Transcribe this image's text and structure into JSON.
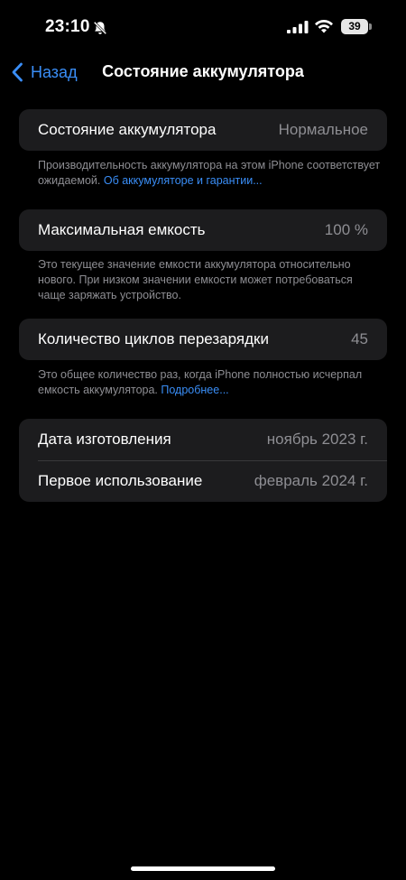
{
  "status_bar": {
    "time": "23:10",
    "battery_level": "39",
    "icons": [
      "bell-slash-icon",
      "cellular-signal-icon",
      "wifi-icon",
      "battery-icon"
    ]
  },
  "nav": {
    "back_label": "Назад",
    "title": "Состояние аккумулятора"
  },
  "sections": {
    "health": {
      "label": "Состояние аккумулятора",
      "value": "Нормальное",
      "note": "Производительность аккумулятора на этом iPhone соответствует ожидаемой.",
      "note_link": "Об аккумуляторе и гарантии..."
    },
    "capacity": {
      "label": "Максимальная емкость",
      "value": "100 %",
      "note": "Это текущее значение емкости аккумулятора относительно нового. При низком значении емкости может потребоваться чаще заряжать устройство."
    },
    "cycles": {
      "label": "Количество циклов перезарядки",
      "value": "45",
      "note": "Это общее количество раз, когда iPhone полностью исчерпал емкость аккумулятора.",
      "note_link": "Подробнее..."
    },
    "dates": {
      "manufacture_label": "Дата изготовления",
      "manufacture_value": "ноябрь 2023 г.",
      "first_use_label": "Первое использование",
      "first_use_value": "февраль 2024 г."
    }
  },
  "colors": {
    "background": "#000000",
    "cell": "#1c1c1e",
    "accent": "#3a8ef7",
    "secondary_text": "#8e8e93"
  }
}
